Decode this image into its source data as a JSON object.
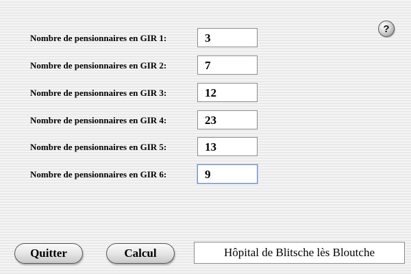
{
  "help": {
    "glyph": "?"
  },
  "rows": [
    {
      "label": "Nombre de pensionnaires en GIR 1:",
      "value": "3"
    },
    {
      "label": "Nombre de pensionnaires en GIR 2:",
      "value": "7"
    },
    {
      "label": "Nombre de pensionnaires en GIR 3:",
      "value": "12"
    },
    {
      "label": "Nombre de pensionnaires en GIR 4:",
      "value": "23"
    },
    {
      "label": "Nombre de pensionnaires en GIR 5:",
      "value": "13"
    },
    {
      "label": "Nombre de pensionnaires en GIR 6:",
      "value": "9"
    }
  ],
  "buttons": {
    "quit_label": "Quitter",
    "calc_label": "Calcul"
  },
  "hospital_name": "Hôpital de Blitsche lès Bloutche",
  "colors": {
    "focus_ring": "#6f8fbf"
  }
}
